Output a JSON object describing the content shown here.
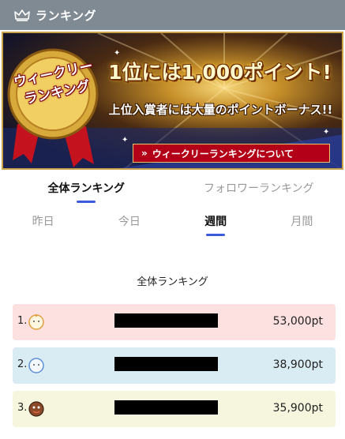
{
  "header": {
    "title": "ランキング",
    "icon": "crown-icon"
  },
  "banner": {
    "medal_text_1": "ウィークリー",
    "medal_text_2": "ランキング",
    "headline": "1位には1,000ポイント!",
    "subline": "上位入賞者には大量のポイントボーナス!!",
    "link_label": "ウィークリーランキングについて",
    "link_chevron": "»"
  },
  "main_tabs": [
    {
      "label": "全体ランキング",
      "active": true
    },
    {
      "label": "フォロワーランキング",
      "active": false
    }
  ],
  "sub_tabs": [
    {
      "label": "昨日",
      "active": false
    },
    {
      "label": "今日",
      "active": false
    },
    {
      "label": "週間",
      "active": true
    },
    {
      "label": "月間",
      "active": false
    }
  ],
  "section_title": "全体ランキング",
  "ranking": [
    {
      "rank": "1.",
      "points": "53,000pt",
      "color": "#fde0e0"
    },
    {
      "rank": "2.",
      "points": "38,900pt",
      "color": "#d9ebf3"
    },
    {
      "rank": "3.",
      "points": "35,900pt",
      "color": "#f6f6df"
    }
  ],
  "colors": {
    "accent": "#3b5bdb",
    "header_bg": "#7f8a93",
    "banner_link_bg": "#b30018"
  }
}
